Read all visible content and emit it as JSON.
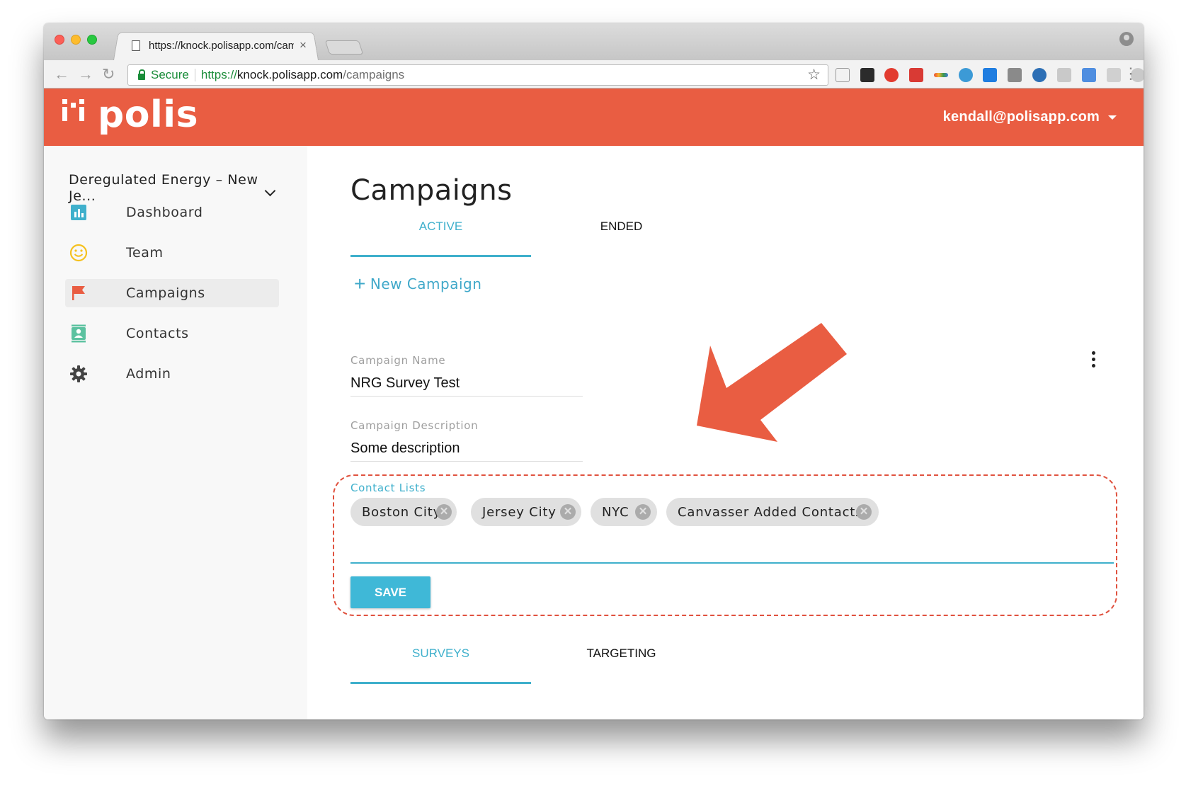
{
  "browser": {
    "tab_title": "https://knock.polisapp.com/campaigns",
    "tab_close": "×",
    "secure_label": "Secure",
    "url_scheme": "https://",
    "url_host": "knock.polisapp.com",
    "url_path": "/campaigns"
  },
  "header": {
    "logo_text": "polis",
    "user_email": "kendall@polisapp.com"
  },
  "sidebar": {
    "org_name": "Deregulated Energy – New Je...",
    "items": [
      {
        "label": "Dashboard",
        "icon": "chart-icon"
      },
      {
        "label": "Team",
        "icon": "smiley-icon"
      },
      {
        "label": "Campaigns",
        "icon": "flag-icon",
        "active": true
      },
      {
        "label": "Contacts",
        "icon": "contact-card-icon"
      },
      {
        "label": "Admin",
        "icon": "gear-icon"
      }
    ]
  },
  "main": {
    "title": "Campaigns",
    "status_tabs": [
      "ACTIVE",
      "ENDED"
    ],
    "new_campaign": "New Campaign",
    "campaign_name_label": "Campaign Name",
    "campaign_name": "NRG Survey Test",
    "description_label": "Campaign Description",
    "description": "Some description",
    "contact_lists_label": "Contact Lists",
    "contact_lists": [
      "Boston City",
      "Jersey City",
      "NYC",
      "Canvasser Added Contacts"
    ],
    "save_label": "SAVE",
    "section_tabs": [
      "SURVEYS",
      "TARGETING"
    ]
  },
  "colors": {
    "brand": "#e95d42",
    "accent": "#3fb0cc",
    "annotation": "#e0523f"
  }
}
